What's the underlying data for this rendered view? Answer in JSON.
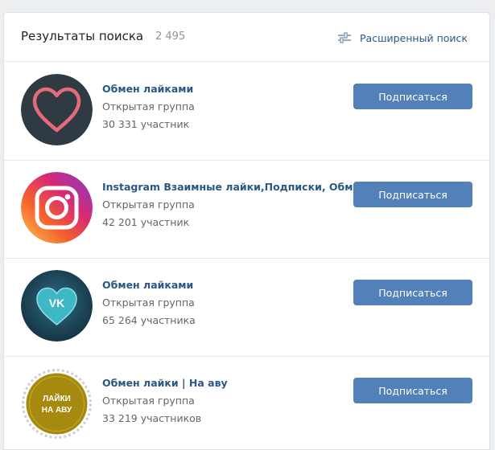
{
  "header": {
    "title": "Результаты поиска",
    "count": "2 495",
    "advanced_search_label": "Расширенный поиск",
    "advanced_search_icon": "sliders-icon"
  },
  "colors": {
    "accent": "#5181b8",
    "link": "#2a5885",
    "muted": "#656565",
    "background": "#edeef0"
  },
  "results": [
    {
      "name": "Обмен лайками",
      "type": "Открытая группа",
      "members": "30 331 участник",
      "button": "Подписаться",
      "avatar": "heart-logo-icon"
    },
    {
      "name": "Instagram Взаимные лайки,Подписки, Обмен",
      "type": "Открытая группа",
      "members": "42 201 участник",
      "button": "Подписаться",
      "avatar": "instagram-logo-icon"
    },
    {
      "name": "Обмен лайками",
      "type": "Открытая группа",
      "members": "65 264 участника",
      "button": "Подписаться",
      "avatar": "vk-heart-logo-icon"
    },
    {
      "name": "Обмен лайки | На аву",
      "type": "Открытая группа",
      "members": "33 219 участников",
      "button": "Подписаться",
      "avatar": "seal-badge-icon",
      "avatar_text": [
        "ЛАЙКИ",
        "НА АВУ"
      ]
    }
  ]
}
